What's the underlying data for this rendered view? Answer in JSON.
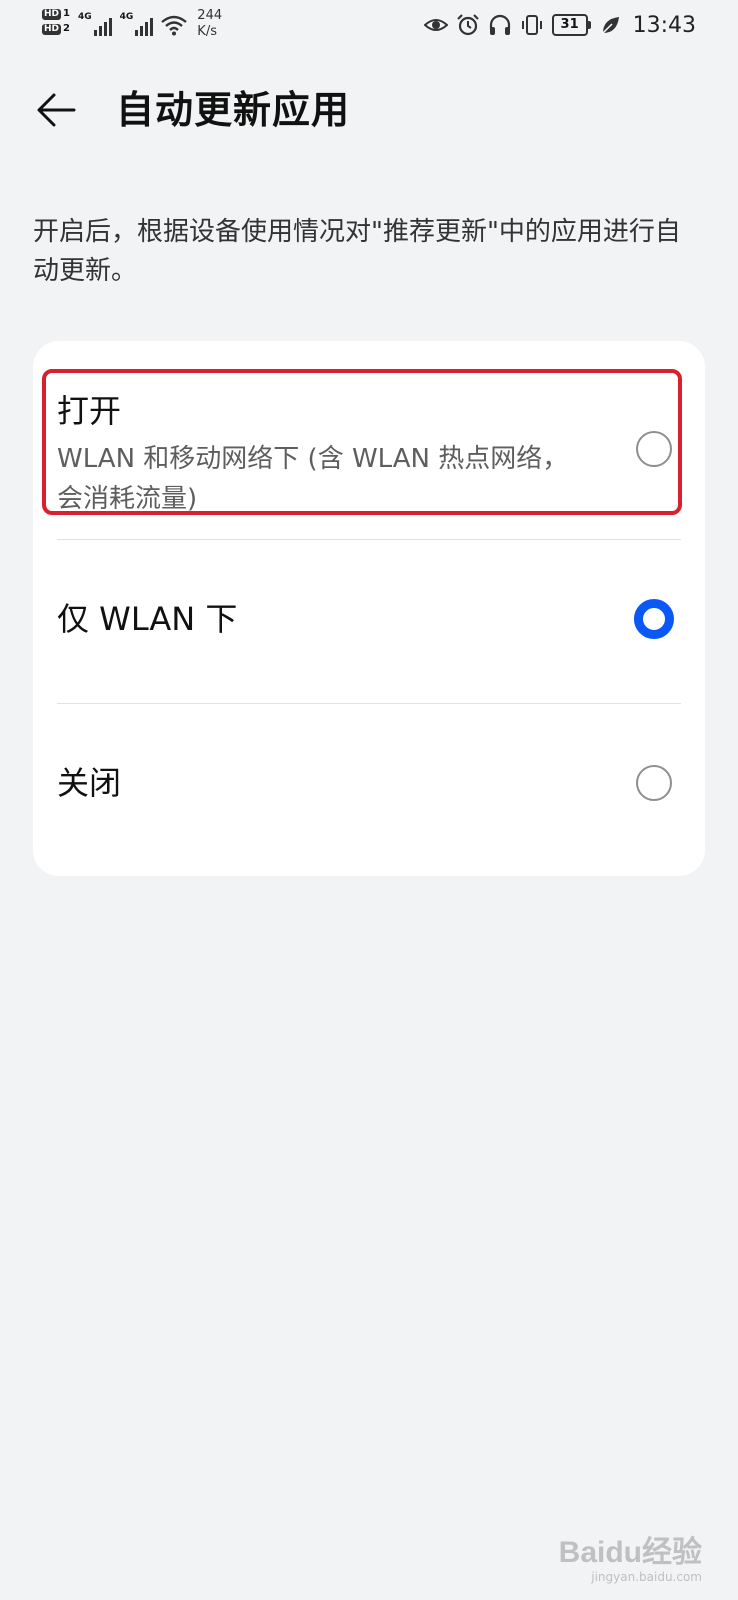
{
  "status_bar": {
    "sim1_label": "HD",
    "sim1_index": "1",
    "sim2_label": "HD",
    "sim2_index": "2",
    "network1": "4G",
    "network2": "4G",
    "speed_value": "244",
    "speed_unit": "K/s",
    "battery_level": "31",
    "time": "13:43",
    "icons": [
      "eye-icon",
      "alarm-icon",
      "headphones-icon",
      "vibrate-icon",
      "leaf-icon",
      "wifi-icon",
      "signal-icon"
    ]
  },
  "header": {
    "title": "自动更新应用",
    "back_icon": "arrow-left-icon"
  },
  "description": "开启后，根据设备使用情况对\"推荐更新\"中的应用进行自动更新。",
  "options": [
    {
      "label": "打开",
      "sublabel": "WLAN 和移动网络下 (含 WLAN 热点网络，会消耗流量)",
      "selected": false,
      "highlighted": true
    },
    {
      "label": "仅 WLAN 下",
      "selected": true,
      "highlighted": false
    },
    {
      "label": "关闭",
      "selected": false,
      "highlighted": false
    }
  ],
  "colors": {
    "accent": "#0a59f7",
    "highlight": "#d8202f",
    "background": "#f1f3f5",
    "card": "#ffffff"
  },
  "watermark": {
    "main": "Baidu经验",
    "sub": "jingyan.baidu.com"
  }
}
